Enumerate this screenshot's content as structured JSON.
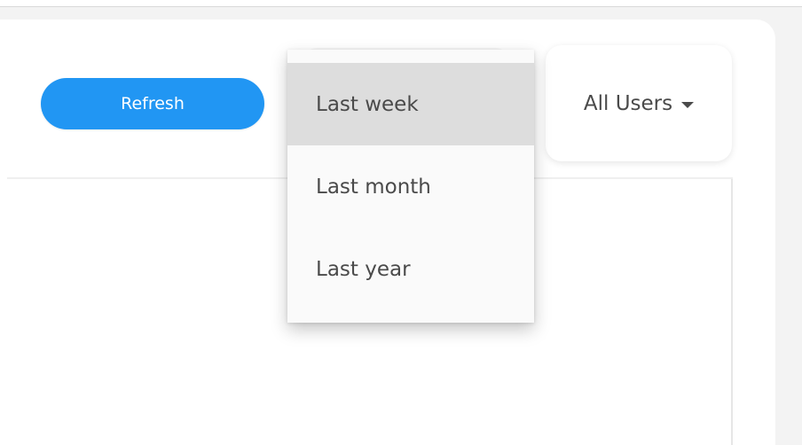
{
  "toolbar": {
    "refresh_label": "Refresh",
    "users_filter": {
      "selected": "All Users"
    }
  },
  "time_filter": {
    "options": [
      {
        "label": "Last week",
        "active": true
      },
      {
        "label": "Last month",
        "active": false
      },
      {
        "label": "Last year",
        "active": false
      }
    ]
  },
  "colors": {
    "accent": "#2196f3",
    "menu_highlight": "#dddddd",
    "text": "#4a4a4a"
  },
  "icons": {
    "users_dropdown": "caret-down-icon"
  }
}
